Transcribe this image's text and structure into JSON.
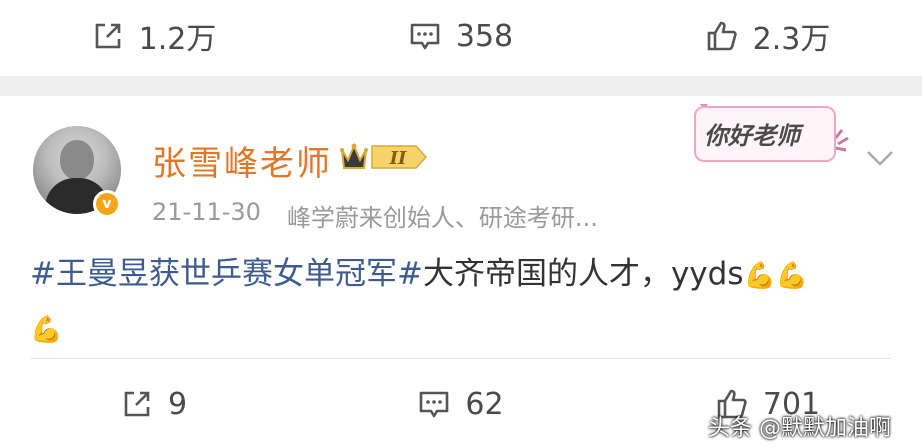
{
  "top_actions": {
    "repost": {
      "icon": "share-icon",
      "count": "1.2万"
    },
    "comment": {
      "icon": "comment-icon",
      "count": "358"
    },
    "like": {
      "icon": "thumbs-up-icon",
      "count": "2.3万"
    }
  },
  "post": {
    "username": "张雪峰老师",
    "vip_badge_text": "II",
    "verified_mark": "v",
    "date": "21-11-30",
    "bio": "峰学蔚来创始人、研途考研...",
    "card_decoration_text": "你好老师",
    "text_topic": "#王曼昱获世乒赛女单冠军#",
    "text_body": "大齐帝国的人才，yyds",
    "emoji": "💪",
    "colors": {
      "username": "#e0782a",
      "topic_link": "#3d5b8f"
    }
  },
  "bottom_actions": {
    "repost": {
      "icon": "share-icon",
      "count": "9"
    },
    "comment": {
      "icon": "comment-icon",
      "count": "62"
    },
    "like": {
      "icon": "thumbs-up-icon",
      "count": "701"
    }
  },
  "watermark": "头条 @默默加油啊"
}
